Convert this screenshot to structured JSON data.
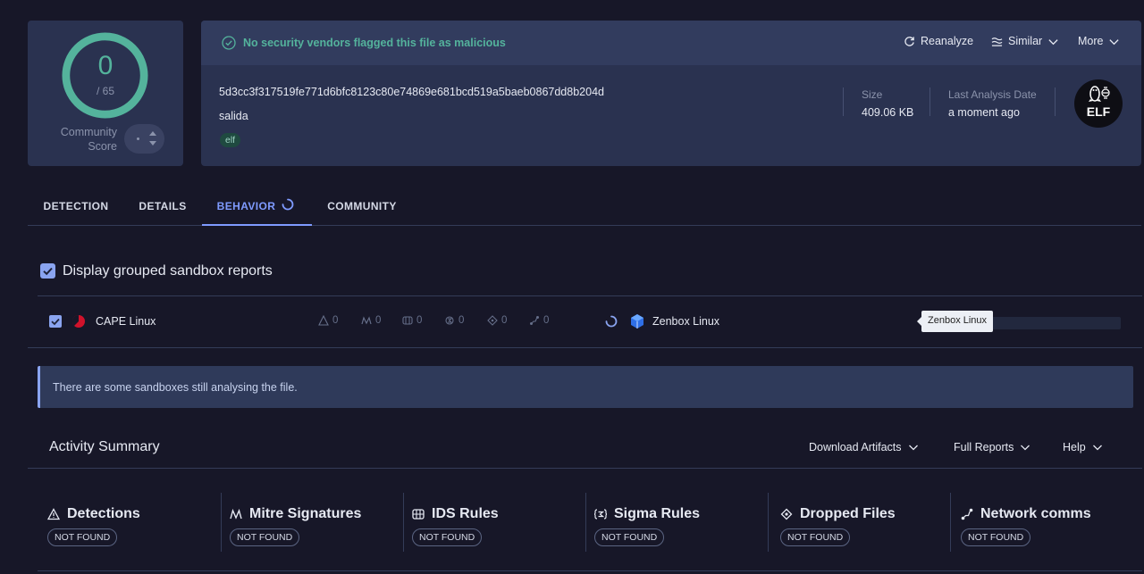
{
  "score": {
    "value": "0",
    "total": "/ 65",
    "community_label": "Community\nScore"
  },
  "file": {
    "status": "No security vendors flagged this file as malicious",
    "actions": {
      "reanalyze": "Reanalyze",
      "similar": "Similar",
      "more": "More"
    },
    "hash": "5d3cc3f317519fe771d6bfc8123c80e74869e681bcd519a5baeb0867dd8b204d",
    "name": "salida",
    "tag": "elf",
    "size_label": "Size",
    "size_value": "409.06 KB",
    "last_analysis_label": "Last Analysis Date",
    "last_analysis_value": "a moment ago",
    "type_badge": "ELF"
  },
  "tabs": {
    "detection": "DETECTION",
    "details": "DETAILS",
    "behavior": "BEHAVIOR",
    "community": "COMMUNITY"
  },
  "grouped_label": "Display grouped sandbox reports",
  "sandboxes": {
    "cape": {
      "label": "CAPE Linux",
      "stats": {
        "detections": "0",
        "mitre": "0",
        "ids": "0",
        "sigma": "0",
        "dropped": "0",
        "network": "0"
      }
    },
    "zenbox": {
      "label": "Zenbox Linux",
      "tooltip": "Zenbox Linux"
    }
  },
  "info_message": "There are some sandboxes still analysing the file.",
  "activity": {
    "title": "Activity Summary",
    "download": "Download Artifacts",
    "full_reports": "Full Reports",
    "help": "Help",
    "sections": [
      {
        "title": "Detections",
        "status": "NOT FOUND"
      },
      {
        "title": "Mitre Signatures",
        "status": "NOT FOUND"
      },
      {
        "title": "IDS Rules",
        "status": "NOT FOUND"
      },
      {
        "title": "Sigma Rules",
        "status": "NOT FOUND"
      },
      {
        "title": "Dropped Files",
        "status": "NOT FOUND"
      },
      {
        "title": "Network comms",
        "status": "NOT FOUND"
      }
    ]
  },
  "colors": {
    "accent": "#7f9bff",
    "success": "#54b39c",
    "card": "#2a3250",
    "background": "#171728"
  }
}
